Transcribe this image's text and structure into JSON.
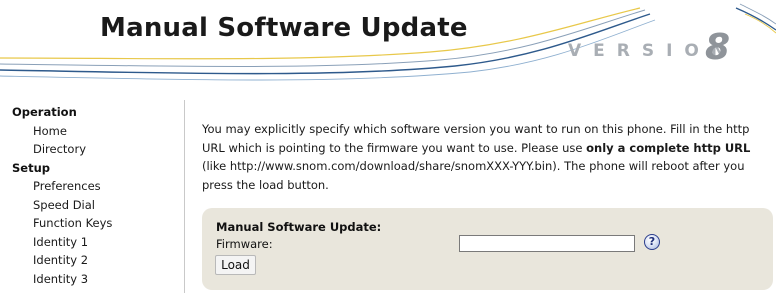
{
  "header": {
    "title": "Manual Software Update",
    "version_label": "VERSION",
    "version_number": "8"
  },
  "sidebar": {
    "sections": [
      {
        "label": "Operation",
        "items": [
          "Home",
          "Directory"
        ]
      },
      {
        "label": "Setup",
        "items": [
          "Preferences",
          "Speed Dial",
          "Function Keys",
          "Identity 1",
          "Identity 2",
          "Identity 3"
        ]
      }
    ]
  },
  "content": {
    "intro_before": "You may explicitly specify which software version you want to run on this phone. Fill in the http URL which is pointing to the firmware you want to use. Please use ",
    "intro_bold": "only a complete http URL",
    "intro_after": " (like http://www.snom.com/download/share/snomXXX-YYY.bin). The phone will reboot after you press the load button.",
    "panel": {
      "title": "Manual Software Update:",
      "firmware_label": "Firmware:",
      "firmware_value": "",
      "help_glyph": "?",
      "load_label": "Load"
    }
  },
  "icons": {
    "help": "question-mark-icon"
  },
  "colors": {
    "panel_bg": "#e9e6dc",
    "swoosh_blue": "#2e5a8c",
    "swoosh_yellow": "#e8c84a"
  }
}
